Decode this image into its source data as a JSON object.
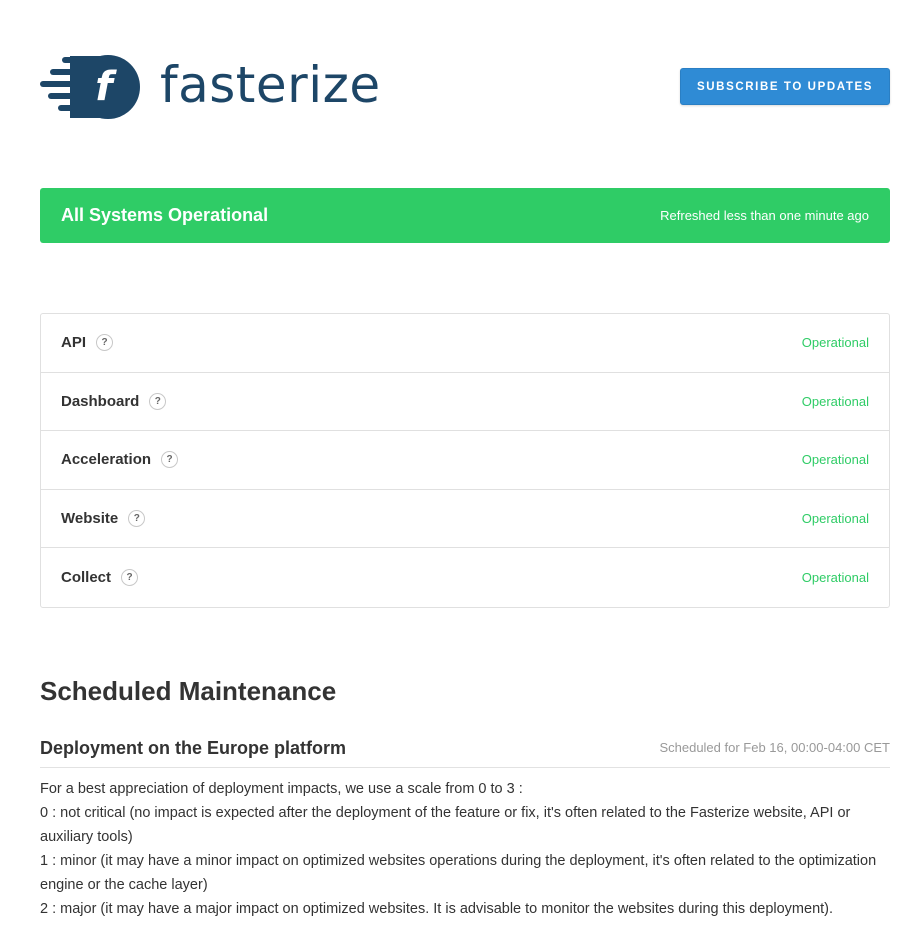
{
  "header": {
    "logo_text": "fasterize",
    "logo_letter": "f",
    "subscribe_label": "SUBSCRIBE TO UPDATES"
  },
  "status": {
    "title": "All Systems Operational",
    "refreshed": "Refreshed less than one minute ago",
    "color": "#2fcc66"
  },
  "components": [
    {
      "name": "API",
      "help": "?",
      "status": "Operational"
    },
    {
      "name": "Dashboard",
      "help": "?",
      "status": "Operational"
    },
    {
      "name": "Acceleration",
      "help": "?",
      "status": "Operational"
    },
    {
      "name": "Website",
      "help": "?",
      "status": "Operational"
    },
    {
      "name": "Collect",
      "help": "?",
      "status": "Operational"
    }
  ],
  "maintenance": {
    "heading": "Scheduled Maintenance",
    "incident": {
      "title": "Deployment on the Europe platform",
      "schedule": "Scheduled for Feb 16, 00:00-04:00 CET",
      "lines": [
        "For a best appreciation of deployment impacts, we use a scale from 0 to 3 :",
        "0 : not critical (no impact is expected after the deployment of the feature or fix, it's often related to the Fasterize website, API or auxiliary tools)",
        "1 : minor (it may have a minor impact on optimized websites operations during the deployment, it's often related to the optimization engine or the cache layer)",
        "2 : major (it may have a major impact on optimized websites. It is advisable to monitor the websites during this deployment)."
      ]
    }
  },
  "colors": {
    "brand_navy": "#1d4667",
    "accent_blue": "#2f8bd5",
    "operational_green": "#2fcc66"
  }
}
